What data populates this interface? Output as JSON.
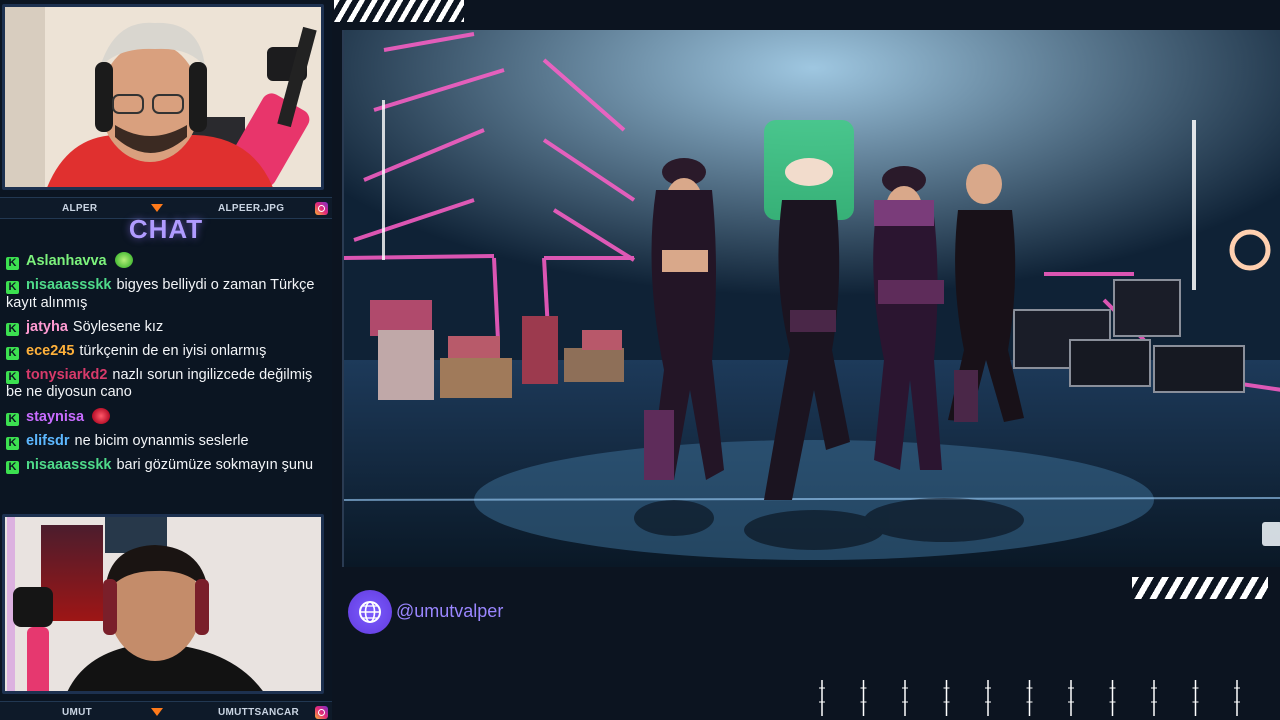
{
  "streamers": {
    "top": {
      "name": "ALPER",
      "handle": "ALPEER.JPG"
    },
    "bottom": {
      "name": "UMUT",
      "handle": "UMUTTSANCAR"
    }
  },
  "chat": {
    "title": "CHAT",
    "messages": [
      {
        "user": "Aslanhavva",
        "color": "#7cf27c",
        "text": "",
        "emote": "green"
      },
      {
        "user": "nisaaassskk",
        "color": "#4fdb8a",
        "text": "bigyes belliydi o zaman Türkçe kayıt alınmış"
      },
      {
        "user": "jatyha",
        "color": "#ff9ad1",
        "text": "Söylesene kız"
      },
      {
        "user": "ece245",
        "color": "#ffb13b",
        "text": "türkçenin de en iyisi onlarmış"
      },
      {
        "user": "tonysiarkd2",
        "color": "#d83a6a",
        "text": "nazlı sorun ingilizcede değilmiş be ne diyosun cano"
      },
      {
        "user": "staynisa",
        "color": "#c86cff",
        "text": "",
        "emote": "red"
      },
      {
        "user": "elifsdr",
        "color": "#5db8ff",
        "text": "ne bicim oynanmis seslerle"
      },
      {
        "user": "nisaaassskk",
        "color": "#4fdb8a",
        "text": "bari gözümüze sokmayın şunu"
      }
    ]
  },
  "social": {
    "icon": "globe-icon",
    "handle": "@umutvalper"
  },
  "colors": {
    "accent": "#b09bff",
    "badge": "#3ce050",
    "panel": "#0b1522"
  }
}
